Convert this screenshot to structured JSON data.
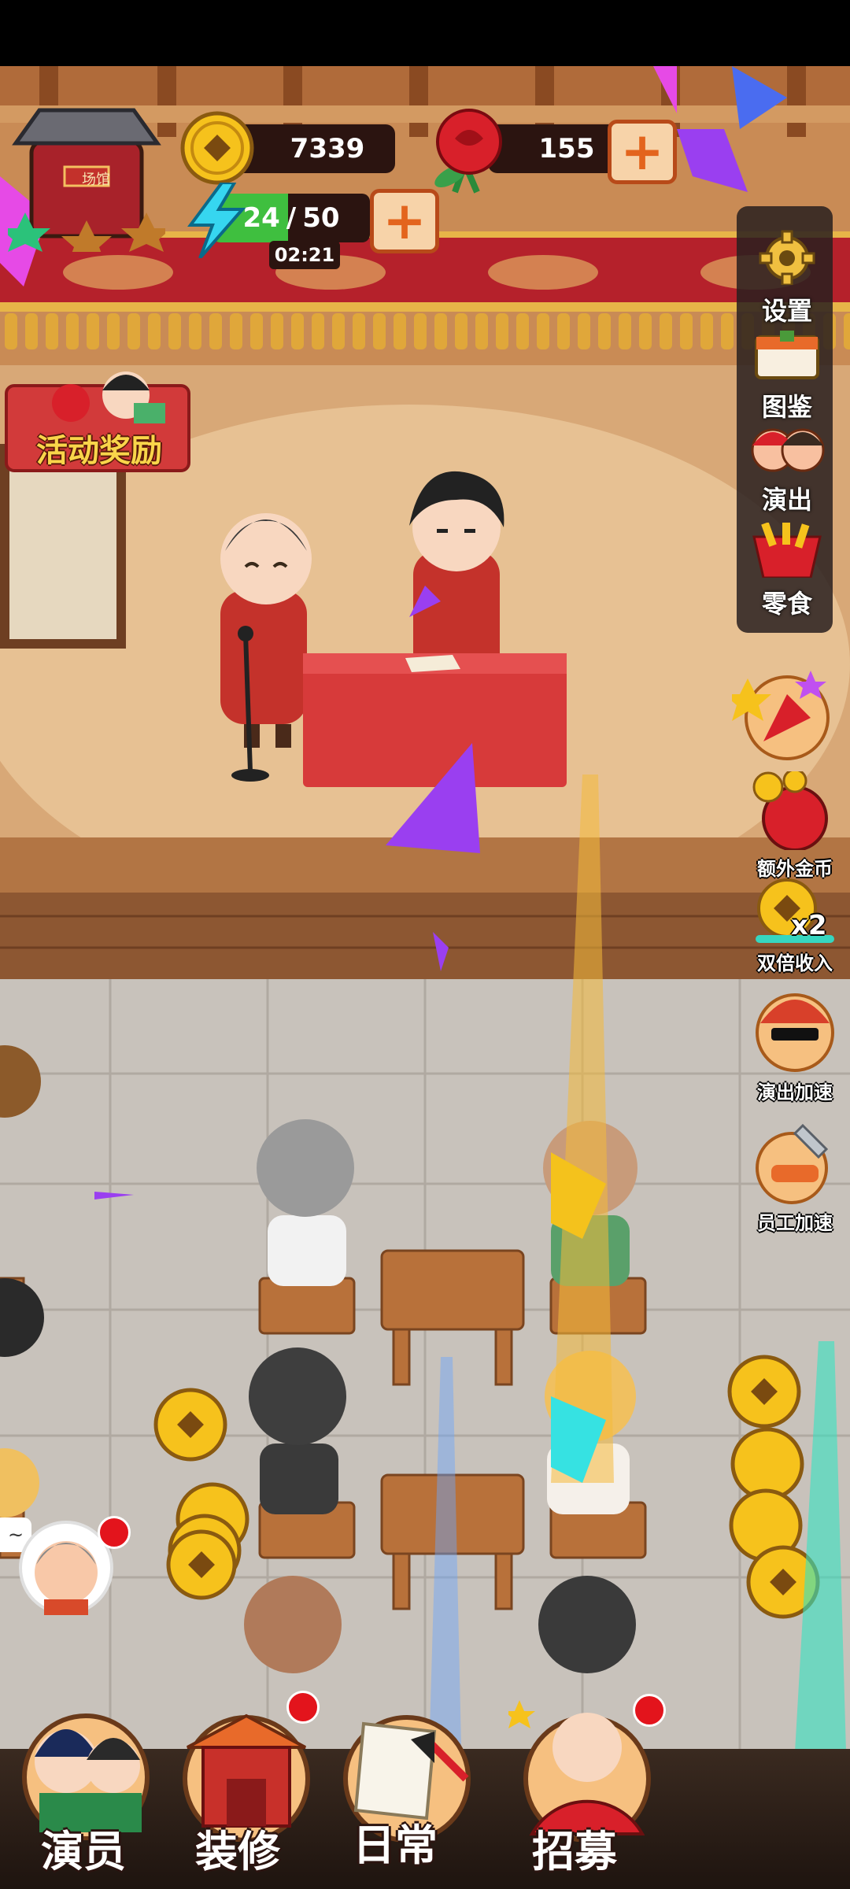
{
  "hud": {
    "coins": "7339",
    "roses": "155",
    "energy_current": "24",
    "energy_max": "50",
    "energy_separator": "/",
    "energy_fraction": 0.48,
    "timer": "02:21",
    "venue_sign": "场馆"
  },
  "event_banner": {
    "label": "活动奖励"
  },
  "side_menu": [
    {
      "label": "设置",
      "icon": "gear-icon"
    },
    {
      "label": "图鉴",
      "icon": "book-icon"
    },
    {
      "label": "演出",
      "icon": "performers-icon"
    },
    {
      "label": "零食",
      "icon": "snack-icon"
    }
  ],
  "features": [
    {
      "label": "额外金币",
      "icon": "money-bag-icon"
    },
    {
      "label": "双倍收入",
      "badge": "x2",
      "icon": "coin-icon"
    },
    {
      "label": "演出加速",
      "icon": "cool-performer-icon"
    },
    {
      "label": "员工加速",
      "icon": "wrench-icon"
    }
  ],
  "bubble_text": "~",
  "bottom_nav": [
    {
      "label": "演员"
    },
    {
      "label": "装修"
    },
    {
      "label": "日常"
    },
    {
      "label": "招募"
    }
  ],
  "colors": {
    "accent": "#e3641d",
    "energy": "#3fbf3f",
    "panel": "#2b1410",
    "badge": "#e3141c"
  }
}
